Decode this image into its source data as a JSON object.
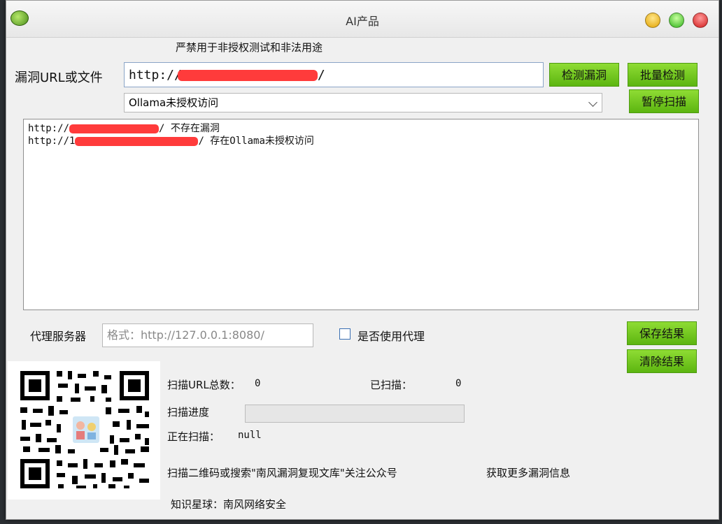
{
  "window": {
    "title": "AI产品",
    "icon": "app-icon"
  },
  "warning": "严禁用于非授权测试和非法用途",
  "target": {
    "label": "漏洞URL或文件",
    "url_prefix": "http://",
    "url_suffix": "/"
  },
  "buttons": {
    "detect": "检测漏洞",
    "batch": "批量检测",
    "pause": "暂停扫描",
    "save": "保存结果",
    "clear": "清除结果"
  },
  "vuln_select": {
    "value": "Ollama未授权访问"
  },
  "results": [
    {
      "prefix": "http://",
      "status": "  不存在漏洞"
    },
    {
      "prefix": "http://1",
      "status": "  存在Ollama未授权访问"
    }
  ],
  "proxy": {
    "label": "代理服务器",
    "placeholder": "格式：http://127.0.0.1:8080/",
    "checkbox_label": "是否使用代理",
    "checked": false
  },
  "stats": {
    "total_label": "扫描URL总数：",
    "total_value": "0",
    "scanned_label": "已扫描：",
    "scanned_value": "0",
    "progress_label": "扫描进度",
    "progress": 0,
    "current_label": "正在扫描：",
    "current_value": "null"
  },
  "footer": {
    "qr_text": "扫描二维码或搜索\"南风漏洞复现文库\"关注公众号",
    "more_info": "获取更多漏洞信息",
    "planet": "知识星球：南风网络安全"
  },
  "colors": {
    "button_green": "#6cc51e",
    "redaction": "#ff3b3b"
  }
}
